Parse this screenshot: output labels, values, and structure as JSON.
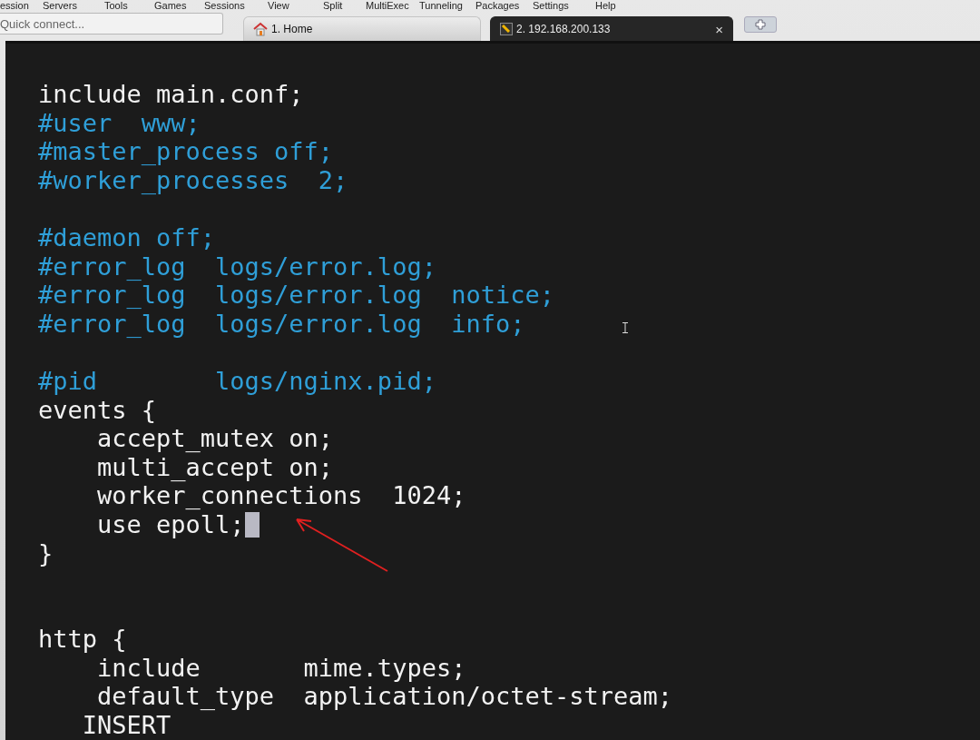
{
  "menu": [
    "ession",
    "Servers",
    "Tools",
    "Games",
    "Sessions",
    "View",
    "Split",
    "MultiExec",
    "Tunneling",
    "Packages",
    "Settings",
    "Help"
  ],
  "quick_connect": {
    "placeholder": "Quick connect..."
  },
  "tabs": [
    {
      "label": "1. Home",
      "kind": "home",
      "selected": false
    },
    {
      "label": "2. 192.168.200.133",
      "kind": "ssh",
      "selected": true
    }
  ],
  "close_tab": "×",
  "terminal": {
    "lines": [
      {
        "kind": "code",
        "text": "include main.conf;",
        "cursor": false
      },
      {
        "kind": "comment",
        "text": "#user  www;",
        "cursor": false
      },
      {
        "kind": "comment",
        "text": "#master_process off;",
        "cursor": false
      },
      {
        "kind": "comment",
        "text": "#worker_processes  2;",
        "cursor": false
      },
      {
        "kind": "blank",
        "cursor": false
      },
      {
        "kind": "comment",
        "text": "#daemon off;",
        "cursor": false
      },
      {
        "kind": "comment",
        "text": "#error_log  logs/error.log;",
        "cursor": false
      },
      {
        "kind": "comment",
        "text": "#error_log  logs/error.log  notice;",
        "cursor": false
      },
      {
        "kind": "comment",
        "text": "#error_log  logs/error.log  info;",
        "cursor": false
      },
      {
        "kind": "blank",
        "cursor": false
      },
      {
        "kind": "comment",
        "text": "#pid        logs/nginx.pid;",
        "cursor": false
      },
      {
        "kind": "code",
        "text": "events {",
        "cursor": false
      },
      {
        "kind": "code",
        "text": "    accept_mutex on;",
        "cursor": false
      },
      {
        "kind": "code",
        "text": "    multi_accept on;",
        "cursor": false
      },
      {
        "kind": "code",
        "text": "    worker_connections  1024;",
        "cursor": false
      },
      {
        "kind": "code",
        "text": "    use epoll;",
        "cursor": true
      },
      {
        "kind": "code",
        "text": "}",
        "cursor": false
      },
      {
        "kind": "blank",
        "cursor": false
      },
      {
        "kind": "blank",
        "cursor": false
      },
      {
        "kind": "code",
        "text": "http {",
        "cursor": false
      },
      {
        "kind": "code",
        "text": "    include       mime.types;",
        "cursor": false
      },
      {
        "kind": "code",
        "text": "    default_type  application/octet-stream;",
        "cursor": false
      }
    ],
    "mode": "INSERT"
  }
}
